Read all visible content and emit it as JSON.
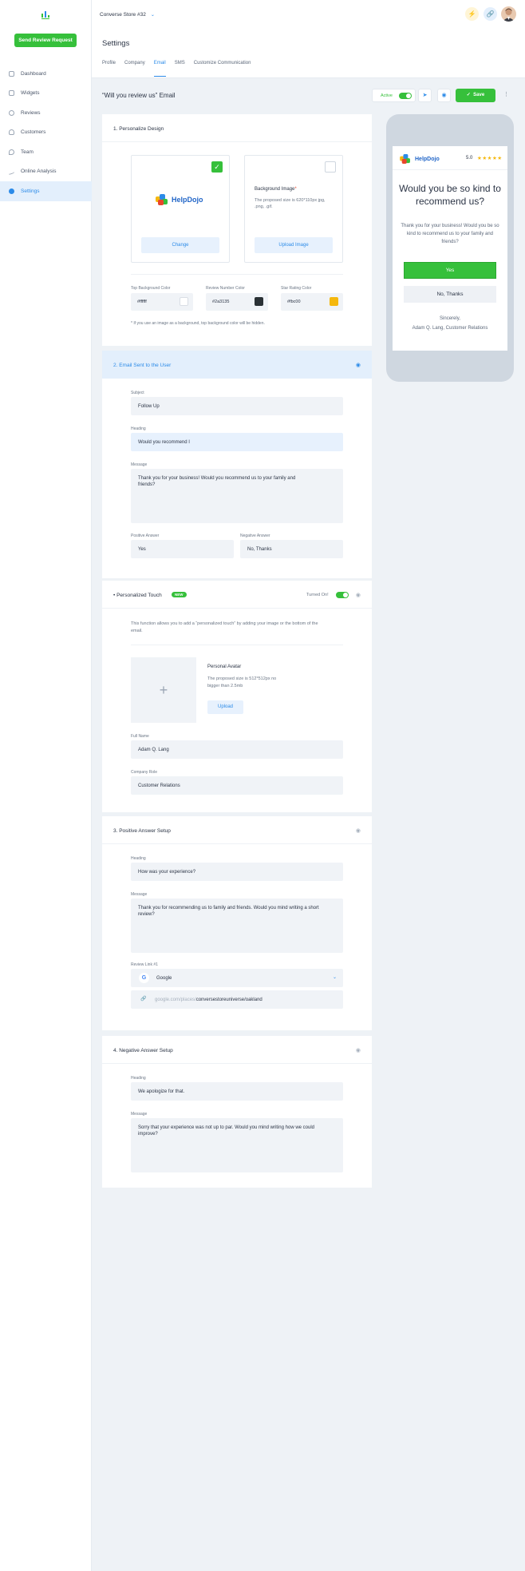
{
  "sidebar": {
    "send_button": "Send Review Request",
    "items": [
      {
        "label": "Dashboard",
        "icon": "dashboard-icon"
      },
      {
        "label": "Widgets",
        "icon": "widgets-icon"
      },
      {
        "label": "Reviews",
        "icon": "reviews-icon"
      },
      {
        "label": "Customers",
        "icon": "customers-icon"
      },
      {
        "label": "Team",
        "icon": "team-icon"
      },
      {
        "label": "Online Analysis",
        "icon": "analysis-icon"
      },
      {
        "label": "Settings",
        "icon": "settings-icon",
        "active": true
      }
    ]
  },
  "header": {
    "store_name": "Converse Store #32",
    "title": "Settings",
    "tabs": [
      "Profile",
      "Company",
      "Email",
      "SMS",
      "Customize Communication"
    ],
    "active_tab": "Email"
  },
  "email": {
    "title": "“Will you review us” Email",
    "active_label": "Active",
    "save_label": "Save"
  },
  "personalize": {
    "title": "1. Personalize Design",
    "logo_text": "HelpDojo",
    "change_btn": "Change",
    "bg_label": "Background Image",
    "bg_required": "*",
    "bg_hint": "The proposed size is 620*110px jpg, .png, .gif.",
    "upload_btn": "Upload Image",
    "colors": [
      {
        "label": "Top Background Color",
        "value": "#ffffff"
      },
      {
        "label": "Review Number Color",
        "value": "#2a3135"
      },
      {
        "label": "Star Rating Color",
        "value": "#fbc00"
      }
    ],
    "swatches": [
      "#ffffff",
      "#2a3135",
      "#f5b80e"
    ],
    "note": "* If you use an image as a background, top background color will be hidden."
  },
  "sent": {
    "title": "2. Email Sent to the User",
    "subject_label": "Subject",
    "subject": "Follow Up",
    "heading_label": "Heading",
    "heading": "Would you recommend I",
    "message_label": "Message",
    "message": "Thank you for your business! Would you recommend us to your family and friends?",
    "positive_label": "Positive Answer",
    "positive": "Yes",
    "negative_label": "Negative Answer",
    "negative": "No, Thanks"
  },
  "touch": {
    "title": "Personalized Touch",
    "badge": "NEW",
    "status": "Turned On!",
    "desc": "This function allows you to add a “personalized touch” by adding your image or the bottom of the email.",
    "avatar_title": "Personal Avatar",
    "avatar_hint": "The proposed size is 512*512px no bigger than 2.5mb",
    "upload_btn": "Upload",
    "name_label": "Full Name",
    "name": "Adam Q. Lang",
    "role_label": "Company Role",
    "role": "Customer Relations"
  },
  "positive": {
    "title": "3. Positive Answer Setup",
    "heading_label": "Heading",
    "heading": "How was your experience?",
    "message_label": "Message",
    "message": "Thank you for recommending us to family and friends. Would you mind writing a short review?",
    "link_label": "Review Link #1",
    "provider": "Google",
    "url_prefix": "google.com/places/",
    "url_path": "conversestoreuniverse/oakland"
  },
  "negative": {
    "title": "4. Negative Answer Setup",
    "heading_label": "Heading",
    "heading": "We apologize for that.",
    "message_label": "Message",
    "message": "Sorry that your experience was not up to par. Would you mind writing how we could improve?"
  },
  "preview": {
    "logo_text": "HelpDojo",
    "rating": "5.0",
    "stars": "★★★★★",
    "heading": "Would you be so kind to recommend us?",
    "message": "Thank you for your business! Would you be so kind to recommend us to your family and friends?",
    "yes": "Yes",
    "no": "No, Thanks",
    "sign_1": "Sincerely,",
    "sign_2": "Adam Q. Lang, Customer Relations"
  },
  "colors": {
    "accent": "#2c8be8",
    "green": "#36c03b",
    "panel_highlight": "#e3effc"
  }
}
